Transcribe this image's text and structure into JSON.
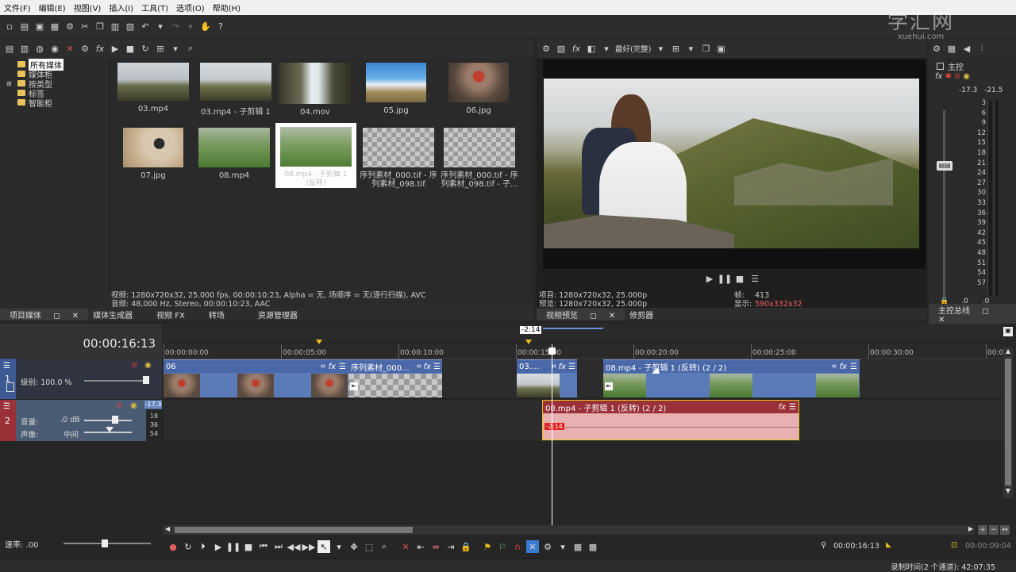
{
  "menu": [
    "文件(F)",
    "编辑(E)",
    "视图(V)",
    "插入(I)",
    "工具(T)",
    "选项(O)",
    "帮助(H)"
  ],
  "watermark": {
    "big": "学汇网",
    "small": "xuehui.com"
  },
  "media_tree": [
    {
      "label": "所有媒体",
      "selected": true
    },
    {
      "label": "媒体柜"
    },
    {
      "label": "按类型"
    },
    {
      "label": "标签"
    },
    {
      "label": "智能柜"
    }
  ],
  "media_items": [
    {
      "label": "03.mp4"
    },
    {
      "label": "03.mp4 - 子剪辑 1"
    },
    {
      "label": "04.mov"
    },
    {
      "label": "05.jpg"
    },
    {
      "label": "06.jpg"
    },
    {
      "label": "07.jpg"
    },
    {
      "label": "08.mp4"
    },
    {
      "label": "08.mp4 - 子剪辑 1 (反转)"
    },
    {
      "label": "序列素材_000.tif - 序列素材_098.tif"
    },
    {
      "label": "序列素材_000.tif - 序列素材_098.tif - 子..."
    }
  ],
  "media_info": {
    "video": "视频: 1280x720x32, 25.000 fps, 00:00:10:23, Alpha = 无, 场顺序 = 无(逐行扫描), AVC",
    "audio": "音频: 48,000 Hz, Stereo, 00:00:10:23, AAC"
  },
  "left_tabs": [
    "项目媒体",
    "媒体生成器",
    "视频 FX",
    "转场",
    "资源管理器"
  ],
  "preview": {
    "quality": "最好(完整)",
    "project": "项目: 1280x720x32, 25.000p",
    "preview_res": "预览: 1280x720x32, 25.000p",
    "frame_label": "帧:",
    "frame_value": "413",
    "display_label": "显示:",
    "display_value": "590x332x32",
    "tabs": [
      "视频预览",
      "修剪器"
    ]
  },
  "master": {
    "title": "主控",
    "levels": [
      "-17.3",
      "-21.5"
    ],
    "ticks": [
      "3",
      "6",
      "9",
      "12",
      "15",
      "18",
      "21",
      "24",
      "27",
      "30",
      "33",
      "36",
      "39",
      "42",
      "45",
      "48",
      "51",
      "54",
      "57"
    ],
    "bottom": [
      "0",
      ".0",
      ".0"
    ],
    "tab": "主控总线"
  },
  "timeline": {
    "timecode": "00:00:16:13",
    "marker_label": "-2:14",
    "ruler": [
      "00:00:00:00",
      "00:00:05:00",
      "00:00:10:00",
      "00:00:15:00",
      "00:00:20:00",
      "00:00:25:00",
      "00:00:30:00",
      "00:0"
    ],
    "video_track": {
      "number": "1",
      "level_label": "级别: 100.0 %"
    },
    "audio_track": {
      "number": "2",
      "volume_label": "音量:",
      "volume_value": ".0 dB",
      "pan_label": "声像:",
      "pan_value": "中间",
      "level_indicator": "-17.3",
      "scale": [
        "18",
        "36",
        "54"
      ]
    },
    "clips": [
      {
        "title": "06"
      },
      {
        "title": "序列素材_000..."
      },
      {
        "title": "03...."
      },
      {
        "title": "08.mp4 - 子剪辑 1 (反转)  (2 / 2)"
      }
    ],
    "audio_clip": {
      "title": "08.mp4 - 子剪辑 1 (反转)  (2 / 2)",
      "badge": "-2:14"
    }
  },
  "status": {
    "rate_label": "速率: .00",
    "cursor_time": "00:00:16:13",
    "selection_length": "00:00:09:04",
    "record_time": "录制时间(2 个通道): 42:07:35"
  }
}
